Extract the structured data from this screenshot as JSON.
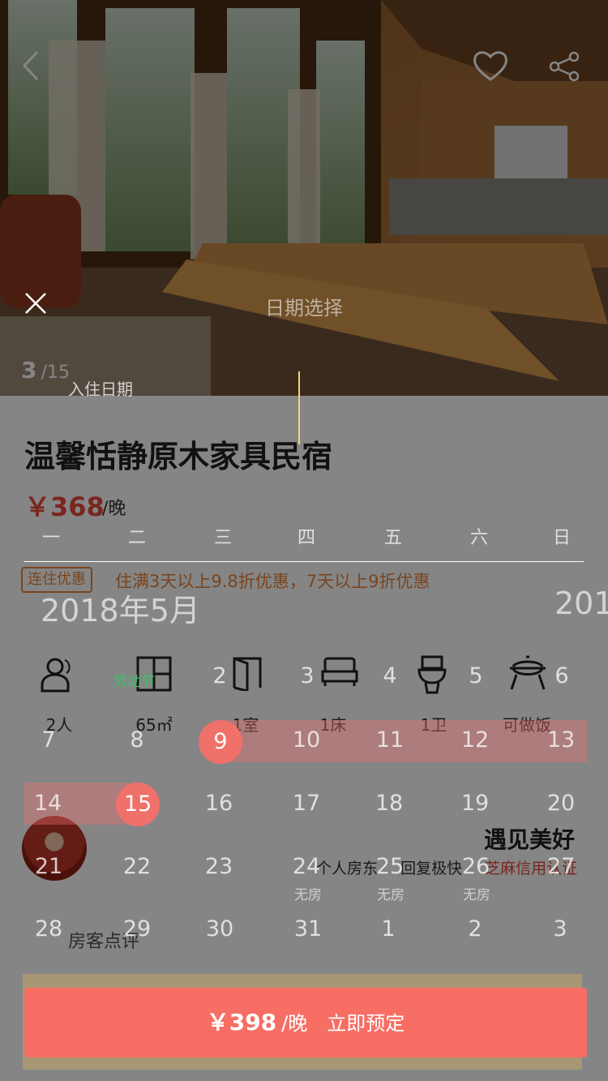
{
  "gallery": {
    "current": "3",
    "total": "/15"
  },
  "listing": {
    "title": "温馨恬静原木家具民宿",
    "price": "￥368",
    "price_unit": "/晚",
    "promo_tag": "连住优惠",
    "promo_text": "住满3天以上9.8折优惠，7天以上9折优惠"
  },
  "features": [
    {
      "icon": "guests-icon",
      "label": "2人"
    },
    {
      "icon": "area-icon",
      "label": "65㎡"
    },
    {
      "icon": "door-icon",
      "label": "1室"
    },
    {
      "icon": "bed-icon",
      "label": "1床"
    },
    {
      "icon": "toilet-icon",
      "label": "1卫"
    },
    {
      "icon": "cooking-icon",
      "label": "可做饭"
    }
  ],
  "host": {
    "name": "遇见美好",
    "tags": [
      "个人房东",
      "回复极快",
      "芝麻信用认证"
    ]
  },
  "reviews_label": "房客点评",
  "date_picker": {
    "title": "日期选择",
    "checkin_label": "入住日期",
    "weekdays": [
      "一",
      "二",
      "三",
      "四",
      "五",
      "六",
      "日"
    ],
    "month_title": "2018年5月",
    "next_month_title_partial": "201",
    "holiday_label": "劳动节",
    "no_room_label": "无房",
    "weeks": [
      [
        "",
        "",
        "2",
        "3",
        "4",
        "5",
        "6"
      ],
      [
        "7",
        "8",
        "9",
        "10",
        "11",
        "12",
        "13"
      ],
      [
        "14",
        "15",
        "16",
        "17",
        "18",
        "19",
        "20"
      ],
      [
        "21",
        "22",
        "23",
        "24",
        "25",
        "26",
        "27"
      ],
      [
        "28",
        "29",
        "30",
        "31",
        "1",
        "2",
        "3"
      ]
    ],
    "selected_start": "9",
    "selected_end": "15"
  },
  "booking": {
    "price": "￥398",
    "unit": "/晚",
    "action": "立即预定"
  },
  "colors": {
    "accent": "#f66e64",
    "price": "#e84a3a",
    "promo": "#e8833a",
    "holiday": "#3fbf6a"
  }
}
